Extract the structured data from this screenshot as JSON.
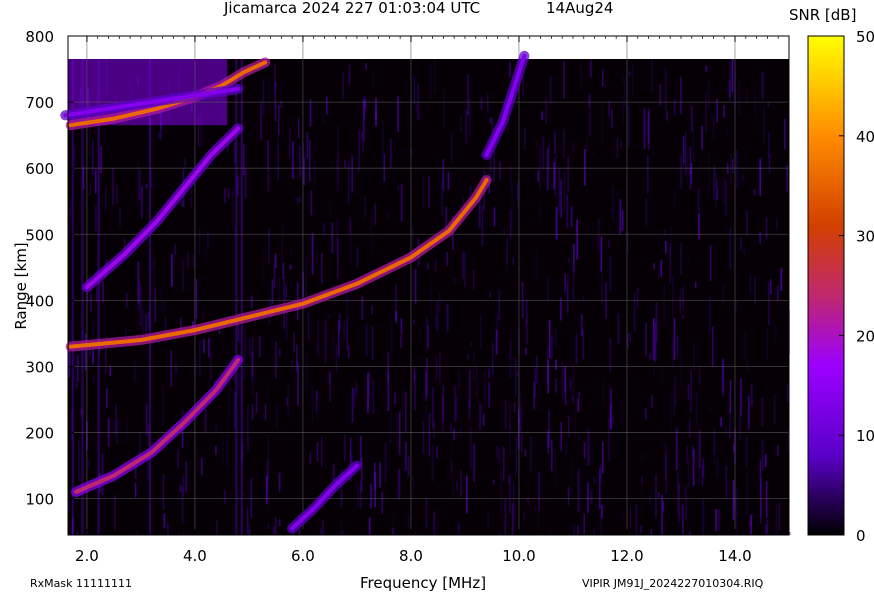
{
  "header": {
    "title": "Jicamarca 2024 227 01:03:04 UTC",
    "date": "14Aug24"
  },
  "footer": {
    "rxmask": "RxMask 11111111",
    "file": "VIPIR  JM91J_2024227010304.RIQ"
  },
  "chart_data": {
    "type": "heatmap",
    "title": "Jicamarca 2024 227 01:03:04 UTC",
    "xlabel": "Frequency [MHz]",
    "ylabel": "Range [km]",
    "xlim": [
      1.65,
      15.0
    ],
    "ylim": [
      45,
      800
    ],
    "xticks": [
      2.0,
      4.0,
      6.0,
      8.0,
      10.0,
      12.0,
      14.0
    ],
    "xtick_labels": [
      "2.0",
      "4.0",
      "6.0",
      "8.0",
      "10.0",
      "12.0",
      "14.0"
    ],
    "yticks": [
      100,
      200,
      300,
      400,
      500,
      600,
      700,
      800
    ],
    "ytick_labels": [
      "100",
      "200",
      "300",
      "400",
      "500",
      "600",
      "700",
      "800"
    ],
    "grid": true,
    "colorbar": {
      "label": "SNR [dB]",
      "range": [
        0,
        50
      ],
      "ticks": [
        0,
        10,
        20,
        30,
        40,
        50
      ],
      "tick_labels": [
        "0",
        "10",
        "20",
        "30",
        "40",
        "50"
      ],
      "colors": [
        "#000000",
        "#5a00c8",
        "#9b00ff",
        "#c0286e",
        "#d24000",
        "#ff8c00",
        "#ffff00"
      ]
    },
    "traces": [
      {
        "points": [
          [
            1.7,
            330
          ],
          [
            3.0,
            340
          ],
          [
            4.0,
            355
          ],
          [
            5.0,
            375
          ],
          [
            6.0,
            395
          ],
          [
            7.0,
            425
          ],
          [
            8.0,
            465
          ],
          [
            8.7,
            505
          ],
          [
            9.2,
            555
          ],
          [
            9.4,
            582
          ]
        ],
        "snr": 36
      },
      {
        "points": [
          [
            1.7,
            665
          ],
          [
            2.5,
            675
          ],
          [
            3.3,
            690
          ],
          [
            4.0,
            708
          ],
          [
            4.5,
            725
          ],
          [
            4.9,
            745
          ],
          [
            5.3,
            760
          ]
        ],
        "snr": 36
      },
      {
        "points": [
          [
            1.8,
            110
          ],
          [
            2.5,
            135
          ],
          [
            3.2,
            170
          ],
          [
            3.8,
            215
          ],
          [
            4.4,
            265
          ],
          [
            4.8,
            310
          ]
        ],
        "snr": 24
      },
      {
        "points": [
          [
            2.0,
            420
          ],
          [
            2.7,
            470
          ],
          [
            3.3,
            520
          ],
          [
            3.8,
            570
          ],
          [
            4.3,
            620
          ],
          [
            4.8,
            660
          ]
        ],
        "snr": 18
      },
      {
        "points": [
          [
            5.8,
            55
          ],
          [
            6.2,
            85
          ],
          [
            6.6,
            120
          ],
          [
            7.0,
            150
          ]
        ],
        "snr": 14
      },
      {
        "points": [
          [
            9.4,
            620
          ],
          [
            9.7,
            670
          ],
          [
            9.9,
            720
          ],
          [
            10.1,
            770
          ]
        ],
        "snr": 14
      },
      {
        "points": [
          [
            1.6,
            680
          ],
          [
            4.8,
            720
          ]
        ],
        "snr": 14
      }
    ]
  }
}
